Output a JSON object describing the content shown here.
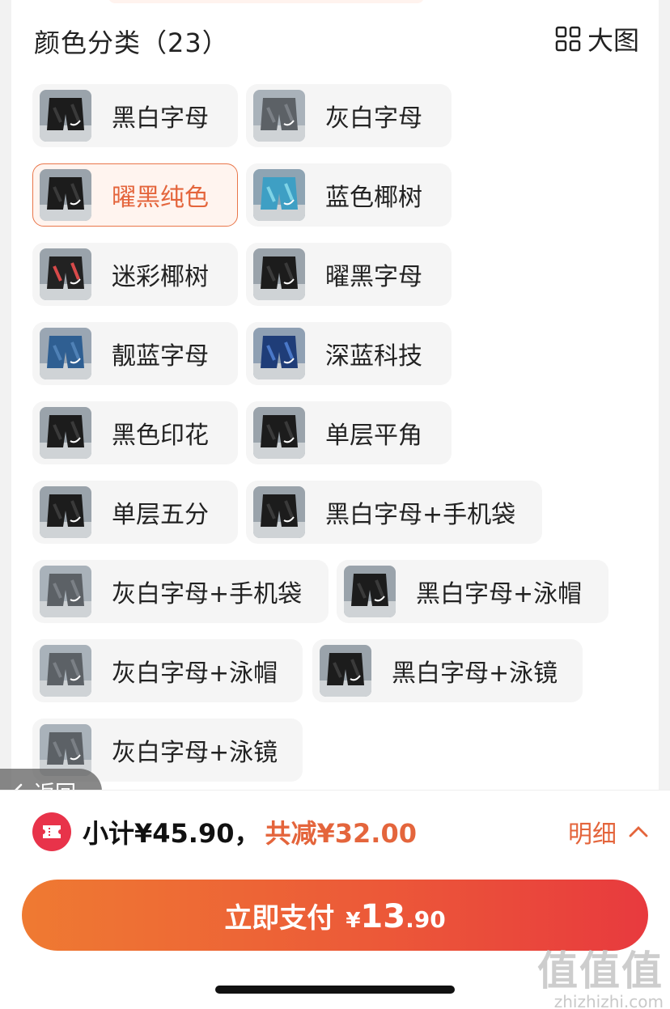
{
  "section": {
    "title": "颜色分类（23）",
    "large_view": "大图"
  },
  "options": [
    {
      "label": "黑白字母",
      "selected": false,
      "thumb": "dark"
    },
    {
      "label": "灰白字母",
      "selected": false,
      "thumb": "gray"
    },
    {
      "label": "曜黑纯色",
      "selected": true,
      "thumb": "dark"
    },
    {
      "label": "蓝色椰树",
      "selected": false,
      "thumb": "teal"
    },
    {
      "label": "迷彩椰树",
      "selected": false,
      "thumb": "camo"
    },
    {
      "label": "曜黑字母",
      "selected": false,
      "thumb": "dark"
    },
    {
      "label": "靓蓝字母",
      "selected": false,
      "thumb": "blue"
    },
    {
      "label": "深蓝科技",
      "selected": false,
      "thumb": "navy"
    },
    {
      "label": "黑色印花",
      "selected": false,
      "thumb": "dark"
    },
    {
      "label": "单层平角",
      "selected": false,
      "thumb": "dark"
    },
    {
      "label": "单层五分",
      "selected": false,
      "thumb": "dark"
    },
    {
      "label": "黑白字母+手机袋",
      "selected": false,
      "thumb": "dark"
    },
    {
      "label": "灰白字母+手机袋",
      "selected": false,
      "thumb": "gray"
    },
    {
      "label": "黑白字母+泳帽",
      "selected": false,
      "thumb": "dark"
    },
    {
      "label": "灰白字母+泳帽",
      "selected": false,
      "thumb": "gray"
    },
    {
      "label": "黑白字母+泳镜",
      "selected": false,
      "thumb": "dark"
    },
    {
      "label": "灰白字母+泳镜",
      "selected": false,
      "thumb": "gray"
    }
  ],
  "back": {
    "label": "返回"
  },
  "summary": {
    "subtotal": "小计¥45.90，",
    "discount": "共减¥32.00",
    "detail": "明细"
  },
  "pay": {
    "label": "立即支付",
    "currency": "¥",
    "integer": "13",
    "decimal": ".90"
  },
  "watermark": {
    "main": "值值值",
    "sub": "zhizhizhi.com"
  },
  "colors": {
    "accent": "#e4653c",
    "pay_start": "#ef7a32",
    "pay_end": "#e83a3e",
    "coupon": "#e8334a"
  }
}
